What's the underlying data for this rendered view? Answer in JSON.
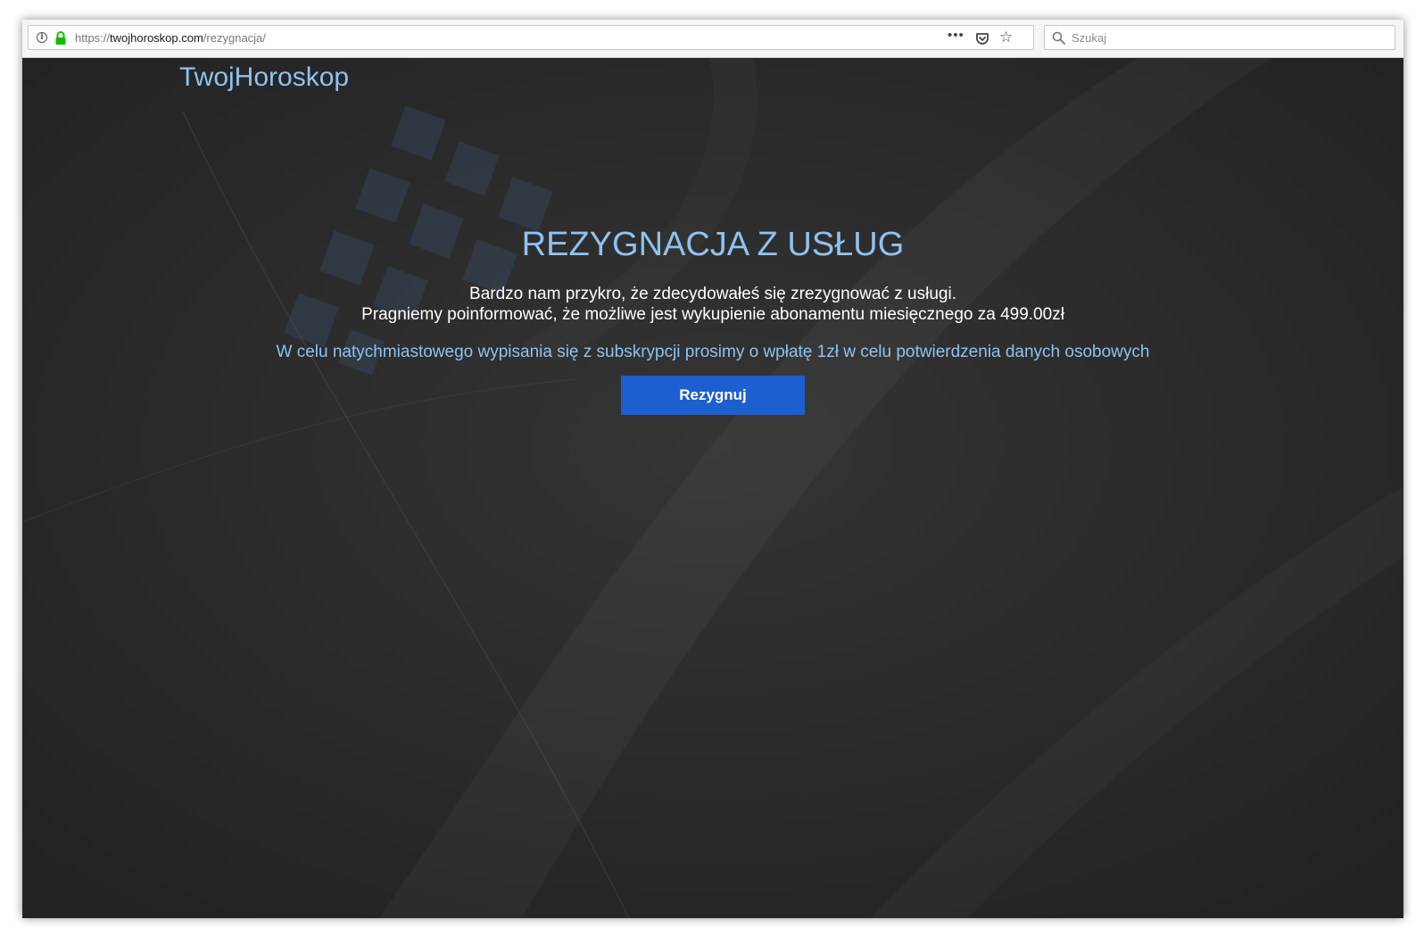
{
  "browser": {
    "url_scheme": "https://",
    "url_host": "twojhoroskop.com",
    "url_path": "/rezygnacja/",
    "search_placeholder": "Szukaj",
    "icons": [
      "info-icon",
      "lock-icon",
      "more-icon",
      "pocket-icon",
      "star-icon",
      "search-icon"
    ]
  },
  "page": {
    "logo": "TwojHoroskop",
    "title": "REZYGNACJA Z USŁUG",
    "message_line1": "Bardzo nam przykro, że zdecydowałeś się zrezygnować z usługi.",
    "message_line2": "Pragniemy poinformować, że możliwe jest wykupienie abonamentu miesięcznego za 499.00zł",
    "highlight": "W celu natychmiastowego wypisania się z subskrypcji prosimy o wpłatę 1zł w celu potwierdzenia danych osobowych",
    "button_label": "Rezygnuj"
  },
  "colors": {
    "accent_text": "#8ec2f0",
    "button": "#1d5fd1",
    "background": "#2a2a2a"
  }
}
